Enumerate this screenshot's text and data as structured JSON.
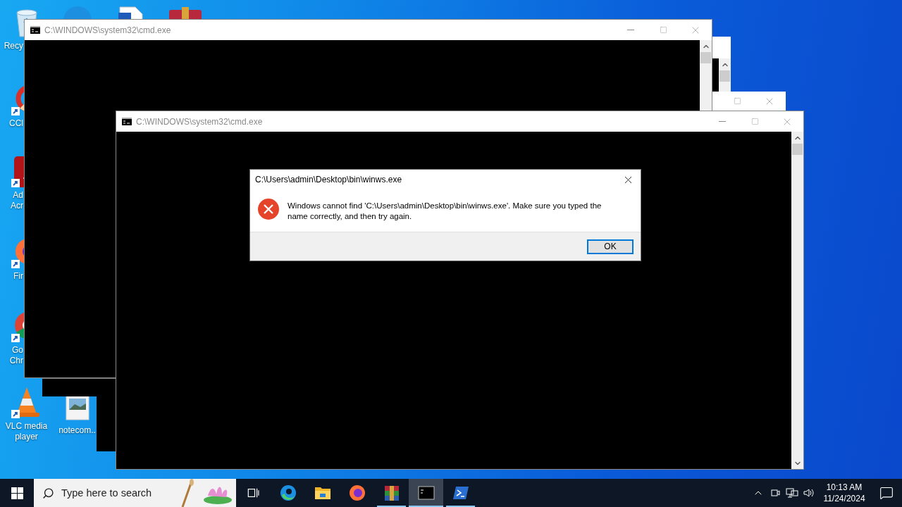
{
  "desktop_icons": [
    {
      "kind": "trash",
      "label_lines": [
        "Recy"
      ],
      "covered": true
    },
    {
      "kind": "ring",
      "label_lines": [
        "CCl"
      ],
      "covered": true
    },
    {
      "kind": "tile",
      "label_lines": [
        "Ad",
        "Acr"
      ],
      "covered": true
    },
    {
      "kind": "fox",
      "label_lines": [
        "Fir"
      ],
      "covered": true
    },
    {
      "kind": "chrome",
      "label_lines": [
        "Go",
        "Chr"
      ],
      "covered": true
    },
    {
      "kind": "cone",
      "label_lines": [
        "VLC media",
        "player"
      ],
      "covered": false
    },
    {
      "kind": "image",
      "label_lines": [
        "notecom.."
      ],
      "covered": false
    }
  ],
  "console_windows": [
    {
      "title": "C:\\WINDOWS\\system32\\cmd.exe"
    },
    {
      "title": "C:\\WINDOWS\\system32\\cmd.exe"
    }
  ],
  "dialog": {
    "title": "C:\\Users\\admin\\Desktop\\bin\\winws.exe",
    "message": "Windows cannot find 'C:\\Users\\admin\\Desktop\\bin\\winws.exe'. Make sure you typed the name correctly, and then try again.",
    "buttons": [
      {
        "label": "OK",
        "default": true
      }
    ]
  },
  "taskbar": {
    "search": {
      "placeholder": "Type here to search"
    },
    "apps": [
      {
        "kind": "taskview",
        "running": false,
        "selected": false
      },
      {
        "kind": "edge",
        "running": false,
        "selected": false
      },
      {
        "kind": "folder",
        "running": false,
        "selected": false
      },
      {
        "kind": "firefox",
        "running": false,
        "selected": false
      },
      {
        "kind": "archive",
        "running": true,
        "selected": false
      },
      {
        "kind": "console",
        "running": true,
        "selected": true
      },
      {
        "kind": "powershell",
        "running": true,
        "selected": false
      }
    ],
    "clock": {
      "time": "10:13 AM",
      "date": "11/24/2024"
    }
  }
}
